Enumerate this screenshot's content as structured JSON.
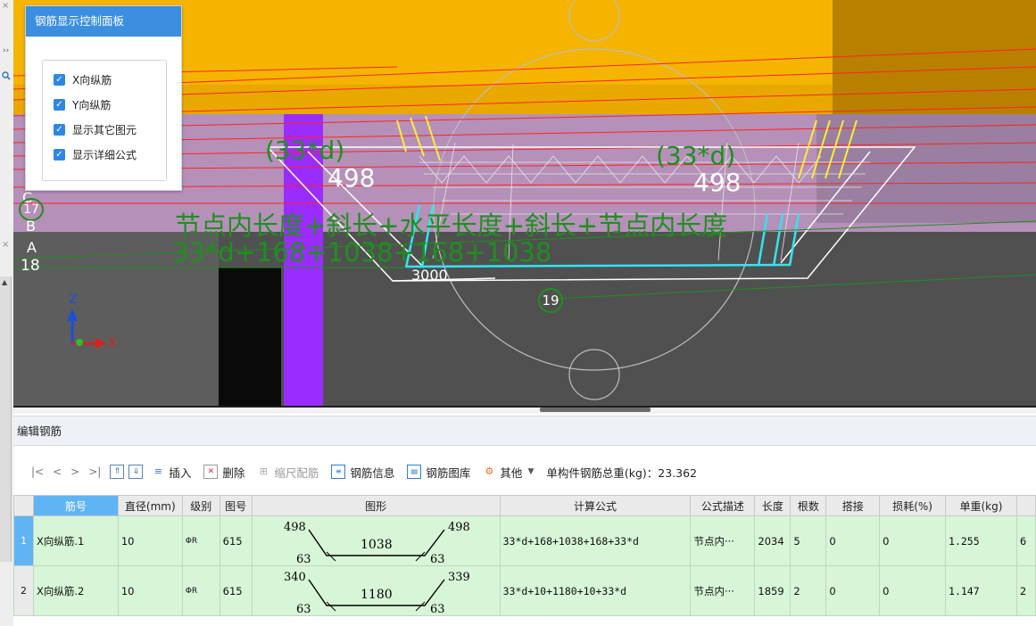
{
  "left_strip": {
    "close_glyph": "×",
    "expand_glyph": "››"
  },
  "control_panel": {
    "title": "钢筋显示控制面板",
    "options": [
      {
        "label": "X向纵筋",
        "checked": true
      },
      {
        "label": "Y向纵筋",
        "checked": true
      },
      {
        "label": "显示其它图元",
        "checked": true
      },
      {
        "label": "显示详细公式",
        "checked": true
      }
    ]
  },
  "viewport": {
    "labels": {
      "d33_left": "(33*d)",
      "v498_left": "498",
      "d33_right": "(33*d)",
      "v498_right": "498",
      "formula_desc": "节点内长度+斜长+水平长度+斜长+节点内长度",
      "formula_expr": "33*d+168+1038+168+1038",
      "bottom_len": "3000",
      "node_19": "19",
      "axis_c": "C",
      "axis_17": "17",
      "axis_b": "B",
      "axis_a": "A",
      "axis_18": "18",
      "gizmo_z": "Z",
      "gizmo_x": "X"
    },
    "colors": {
      "beam": "#f5b400",
      "beam_side": "#b98000",
      "column": "#9a2cff",
      "rebar_x": "#ff2222",
      "rebar_y": "#ffee33",
      "rebar_cyan": "#33e5f0",
      "label_green": "#1f8f1f"
    }
  },
  "rebar_panel": {
    "title": "编辑钢筋",
    "nav": [
      "|<",
      "<",
      ">",
      ">|"
    ],
    "buttons": {
      "insert": "插入",
      "delete": "删除",
      "scale": "缩尺配筋",
      "info": "钢筋信息",
      "library": "钢筋图库",
      "other": "其他"
    },
    "total_weight_label": "单构件钢筋总重(kg)：23.362",
    "columns": [
      "筋号",
      "直径(mm)",
      "级别",
      "图号",
      "图形",
      "计算公式",
      "公式描述",
      "长度",
      "根数",
      "搭接",
      "损耗(%)",
      "单重(kg)",
      ""
    ],
    "rows": [
      {
        "num": "1",
        "name": "X向纵筋.1",
        "diameter": "10",
        "grade": "ΦR",
        "figure_no": "615",
        "shape": {
          "top_left": "498",
          "top_right": "498",
          "middle": "1038",
          "bot_left": "63",
          "bot_right": "63"
        },
        "formula": "33*d+168+1038+168+33*d",
        "desc": "节点内···",
        "length": "2034",
        "count": "5",
        "lap": "0",
        "loss": "0",
        "unit_weight": "1.255",
        "extra": "6"
      },
      {
        "num": "2",
        "name": "X向纵筋.2",
        "diameter": "10",
        "grade": "ΦR",
        "figure_no": "615",
        "shape": {
          "top_left": "340",
          "top_right": "339",
          "middle": "1180",
          "bot_left": "63",
          "bot_right": "63"
        },
        "formula": "33*d+10+1180+10+33*d",
        "desc": "节点内···",
        "length": "1859",
        "count": "2",
        "lap": "0",
        "loss": "0",
        "unit_weight": "1.147",
        "extra": "2"
      }
    ]
  }
}
